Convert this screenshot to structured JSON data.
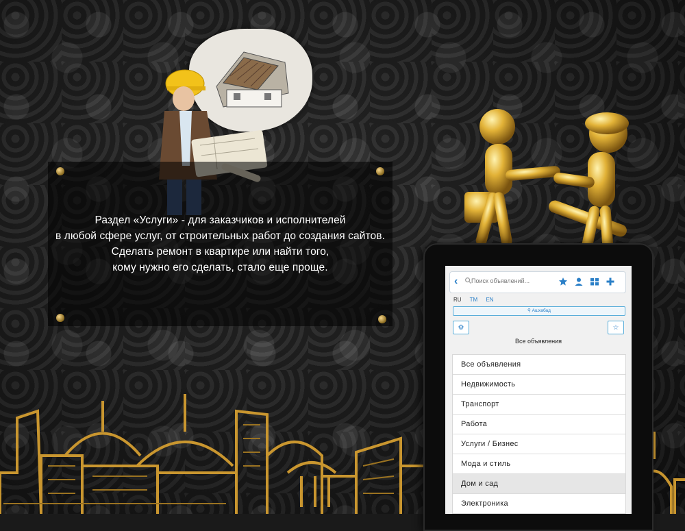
{
  "panel": {
    "lines": [
      "Раздел «Услуги» - для заказчиков и исполнителей",
      "в любой сфере услуг, от строительных работ до создания сайтов.",
      "Сделать ремонт в квартире или найти того,",
      "кому нужно его сделать, стало еще проще."
    ]
  },
  "app": {
    "search_placeholder": "Поиск объявлений...",
    "languages": [
      "RU",
      "TM",
      "EN"
    ],
    "city": "Ашхабад",
    "all_label": "Все объявления",
    "categories": [
      "Все объявления",
      "Недвижимость",
      "Транспорт",
      "Работа",
      "Услуги / Бизнес",
      "Мода и стиль",
      "Дом и сад",
      "Электроника"
    ],
    "icons": {
      "back": "chevron-left-icon",
      "search": "search-icon",
      "favorites": "star-icon",
      "profile": "user-icon",
      "grid": "grid-icon",
      "add": "plus-icon",
      "location": "map-pin-icon",
      "settings": "gear-icon",
      "bookmark": "star-outline-icon"
    },
    "colors": {
      "accent": "#2a7fc7",
      "gold": "#d4a437"
    }
  }
}
